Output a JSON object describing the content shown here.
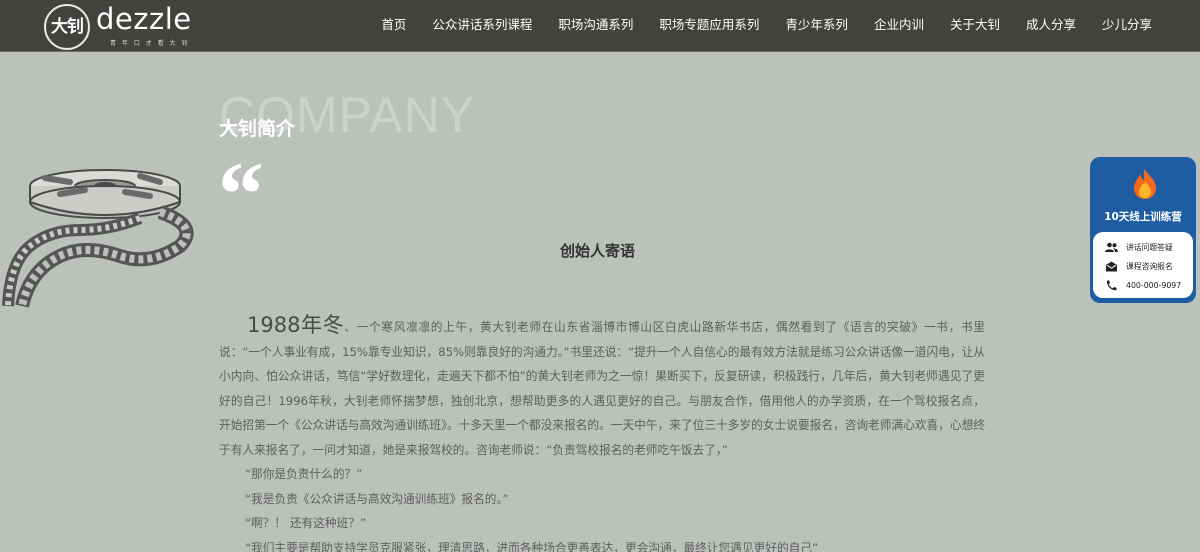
{
  "brand": {
    "logo_char": "大钊",
    "name": "dezzle",
    "tagline": "青 年 口 才 看 大 钊"
  },
  "nav": {
    "items": [
      "首页",
      "公众讲话系列课程",
      "职场沟通系列",
      "职场专题应用系列",
      "青少年系列",
      "企业内训",
      "关于大钊",
      "成人分享",
      "少儿分享"
    ]
  },
  "section": {
    "ghost_word": "COMPANY",
    "title": "大钊简介",
    "quote_mark": "“",
    "founder_title": "创始人寄语"
  },
  "article": {
    "year_lead": "1988年冬",
    "p1_rest": "、一个寒风凛凛的上午，黄大钊老师在山东省淄博市博山区白虎山路新华书店，偶然看到了《语言的突破》一书，书里说：“一个人事业有成，15%靠专业知识，85%则靠良好的沟通力。”书里还说：“提升一个人自信心的最有效方法就是练习公众讲话像一道闪电，让从小内向、怕公众讲话，笃信“学好数理化，走遍天下都不怕”的黄大钊老师为之一惊！果断买下，反复研读，积极践行，几年后，黄大钊老师遇见了更好的自己！1996年秋，大钊老师怀揣梦想，独创北京，想帮助更多的人遇见更好的自己。与朋友合作，借用他人的办学资质，在一个驾校报名点，开始招第一个《公众讲话与高效沟通训练班》。十多天里一个都没来报名的。一天中午，来了位三十多岁的女士说要报名，咨询老师满心欢喜，心想终于有人来报名了，一问才知道，她是来报驾校的。咨询老师说：“负责驾校报名的老师吃午饭去了，”",
    "dialogue": [
      "“那你是负责什么的？”",
      "“我是负责《公众讲话与高效沟通训练班》报名的。”",
      "“啊？！ 还有这种班？”",
      "“我们主要是帮助支持学员克服紧张，理清思路，进而各种场合更善表达，更会沟通，最终让您遇见更好的自己”"
    ]
  },
  "widget": {
    "camp_title": "10天线上训练营",
    "items": [
      {
        "icon": "group-icon",
        "label": "讲话问题答疑"
      },
      {
        "icon": "mail-icon",
        "label": "课程咨询报名"
      },
      {
        "icon": "phone-icon",
        "label": "400-000-9097"
      }
    ]
  },
  "colors": {
    "page_bg": "#bcc1bb",
    "header_bg": "#42423f",
    "widget_blue": "#1f5da3"
  }
}
